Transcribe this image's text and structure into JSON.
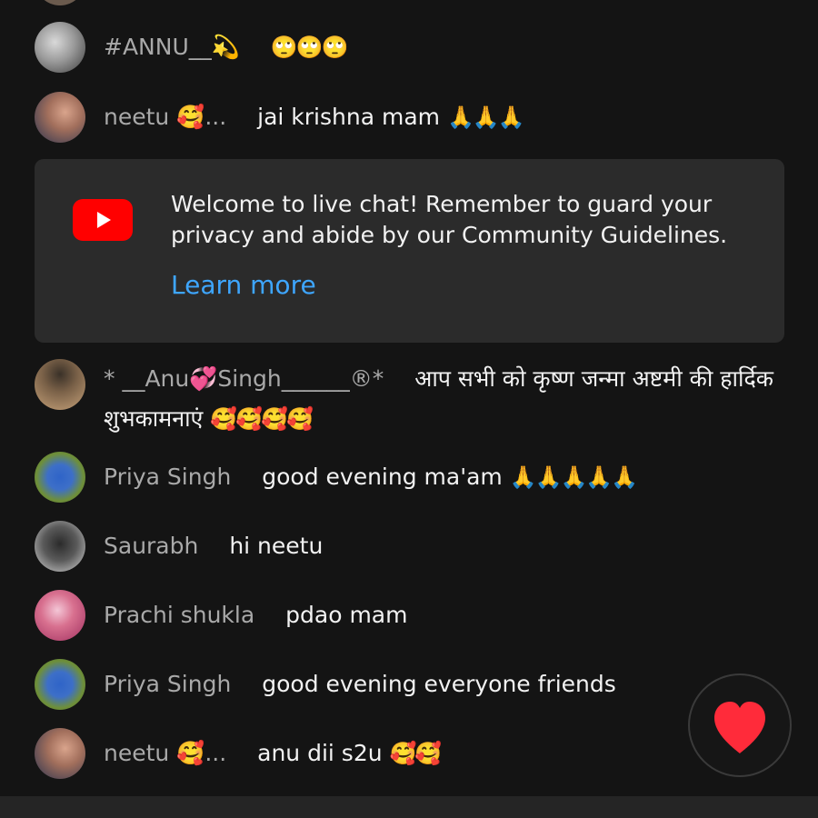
{
  "messages": [
    {
      "author": "#ANNU__💫",
      "text": "",
      "emoji": "🙄🙄🙄"
    },
    {
      "author": "neetu 🥰...",
      "text": "jai krishna mam",
      "emoji": "🙏🙏🙏"
    },
    {
      "author": "* __Anu💞Singh______®*",
      "text": "आप सभी को कृष्ण जन्मा अष्टमी की हार्दिक शुभकामनाएं",
      "emoji": "🥰🥰🥰🥰"
    },
    {
      "author": "Priya Singh",
      "text": "good evening ma'am",
      "emoji": "🙏🙏🙏🙏🙏"
    },
    {
      "author": "Saurabh",
      "text": "hi neetu",
      "emoji": ""
    },
    {
      "author": "Prachi shukla",
      "text": "pdao mam",
      "emoji": ""
    },
    {
      "author": "Priya Singh",
      "text": "good evening everyone friends",
      "emoji": ""
    },
    {
      "author": "neetu 🥰...",
      "text": "anu dii s2u",
      "emoji": "🥰🥰"
    }
  ],
  "welcome": {
    "text": "Welcome to live chat! Remember to guard your privacy and abide by our Community Guidelines.",
    "link": "Learn more",
    "icon": "youtube-logo-icon"
  },
  "reaction": {
    "icon": "heart-icon",
    "color": "#ff2b3a"
  },
  "colors": {
    "background": "#141414",
    "card": "#2b2b2b",
    "link": "#3ea6ff",
    "author": "#a9a9a9"
  }
}
